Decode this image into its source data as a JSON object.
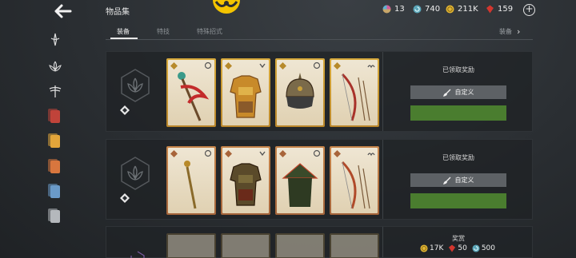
{
  "header": {
    "title": "物品集",
    "currencies": [
      {
        "icon": "orb-icon",
        "value": "13"
      },
      {
        "icon": "spiral-gem-icon",
        "value": "740"
      },
      {
        "icon": "coin-icon",
        "value": "211K"
      },
      {
        "icon": "ruby-icon",
        "value": "159"
      }
    ],
    "add_label": "+"
  },
  "tabs": [
    {
      "label": "装备",
      "active": true
    },
    {
      "label": "特技",
      "active": false
    },
    {
      "label": "特殊招式",
      "active": false
    }
  ],
  "tab_right": {
    "label": "装备",
    "chevron": "›"
  },
  "sidebar": [
    "dagger-icon",
    "lotus-icon",
    "dragonfly-icon",
    "red-card-icon",
    "gold-card-icon",
    "orange-card-icon",
    "blue-card-icon",
    "gray-card-icon"
  ],
  "sets": [
    {
      "status": "已领取奖励",
      "custom_label": "自定义",
      "items": [
        {
          "name": "staff-with-ribbon",
          "rarity": "gold"
        },
        {
          "name": "ornate-armor",
          "rarity": "gold"
        },
        {
          "name": "spiked-helmet",
          "rarity": "gold"
        },
        {
          "name": "bow-and-arrows",
          "rarity": "gold"
        }
      ]
    },
    {
      "status": "已领取奖励",
      "custom_label": "自定义",
      "items": [
        {
          "name": "golden-staff",
          "rarity": "bronze"
        },
        {
          "name": "leather-armor",
          "rarity": "bronze"
        },
        {
          "name": "conical-hat",
          "rarity": "bronze"
        },
        {
          "name": "bow-and-arrows",
          "rarity": "bronze"
        }
      ]
    }
  ],
  "reward": {
    "title": "奖赏",
    "items": [
      {
        "icon": "coin-icon",
        "value": "17K"
      },
      {
        "icon": "ruby-icon",
        "value": "50"
      },
      {
        "icon": "spiral-gem-icon",
        "value": "500"
      }
    ]
  },
  "colors": {
    "gold_frame": "#d7a93a",
    "bronze_frame": "#c7854a",
    "green": "#4a7d2f",
    "button": "#5d6165"
  }
}
